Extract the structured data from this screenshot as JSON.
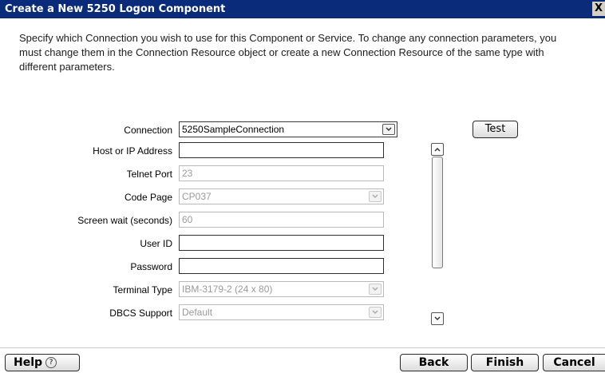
{
  "window": {
    "title": "Create a New 5250 Logon Component",
    "close_label": "X"
  },
  "description": "Specify which Connection you wish to use for this Component or Service.  To change any connection parameters, you must change them in the Connection Resource object or create a new Connection Resource of the same type with different parameters.",
  "form": {
    "connection": {
      "label": "Connection",
      "value": "5250SampleConnection"
    },
    "host": {
      "label": "Host or IP Address",
      "value": ""
    },
    "telnet_port": {
      "label": "Telnet Port",
      "value": "23"
    },
    "code_page": {
      "label": "Code Page",
      "value": "CP037"
    },
    "screen_wait": {
      "label": "Screen wait (seconds)",
      "value": "60"
    },
    "user_id": {
      "label": "User ID",
      "value": ""
    },
    "password": {
      "label": "Password",
      "value": ""
    },
    "terminal_type": {
      "label": "Terminal Type",
      "value": "IBM-3179-2 (24 x 80)"
    },
    "dbcs_support": {
      "label": "DBCS Support",
      "value": "Default"
    }
  },
  "buttons": {
    "test": "Test",
    "help": "Help",
    "help_icon": "?",
    "back": "Back",
    "finish": "Finish",
    "cancel": "Cancel"
  },
  "icons": {
    "dropdown": "chevron-down-icon",
    "scroll_up": "chevron-up-icon",
    "scroll_down": "chevron-down-icon"
  }
}
